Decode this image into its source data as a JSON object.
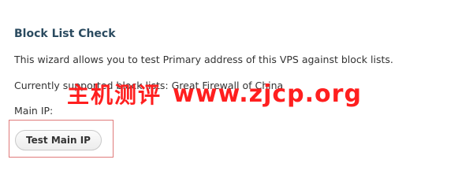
{
  "block_list": {
    "title": "Block List Check",
    "description": "This wizard allows you to test Primary address of this VPS against block lists.",
    "supported": "Currently supported block lists: Great Firewall of China",
    "main_ip_label": "Main IP:",
    "test_button_label": "Test Main IP"
  },
  "watermark": {
    "chinese": "主机测评",
    "url": "www.zjcp.org",
    "color": "#ff1f1f"
  },
  "colors": {
    "title": "#2b4b60",
    "text": "#333333",
    "highlight_border": "#e07a7a"
  }
}
